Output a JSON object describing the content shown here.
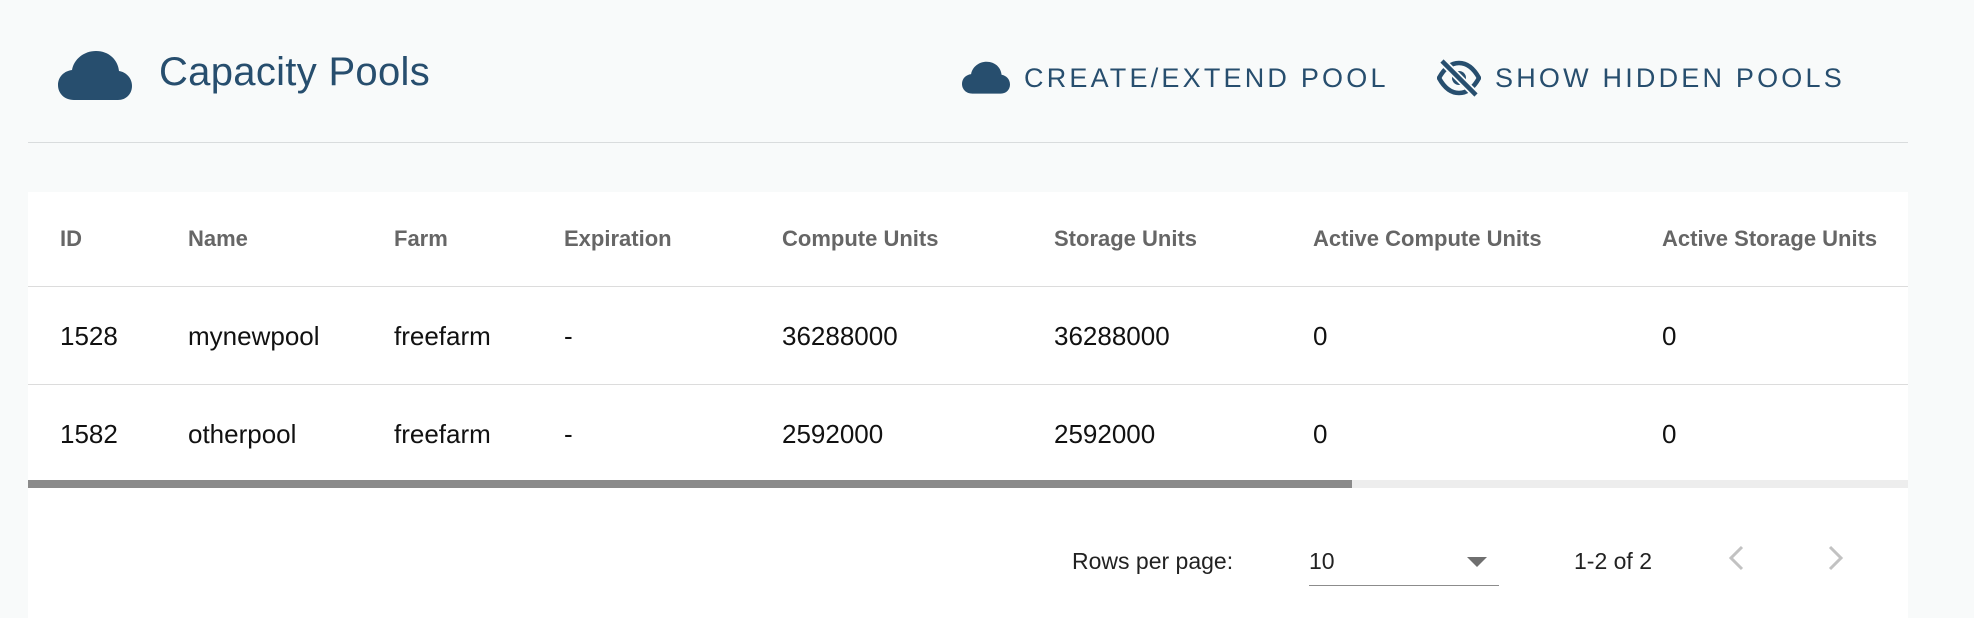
{
  "header": {
    "title": "Capacity Pools",
    "title_icon": "cloud-icon",
    "actions": [
      {
        "label": "CREATE/EXTEND POOL",
        "icon": "cloud-icon"
      },
      {
        "label": "SHOW HIDDEN POOLS",
        "icon": "eye-off-icon"
      }
    ],
    "accent_color": "#274e6e"
  },
  "table": {
    "columns": [
      "ID",
      "Name",
      "Farm",
      "Expiration",
      "Compute Units",
      "Storage Units",
      "Active Compute Units",
      "Active Storage Units"
    ],
    "rows": [
      [
        "1528",
        "mynewpool",
        "freefarm",
        "-",
        "36288000",
        "36288000",
        "0",
        "0"
      ],
      [
        "1582",
        "otherpool",
        "freefarm",
        "-",
        "2592000",
        "2592000",
        "0",
        "0"
      ]
    ]
  },
  "pagination": {
    "rows_per_page_label": "Rows per page:",
    "rows_per_page_value": "10",
    "range": "1-2 of 2",
    "prev_icon": "chevron-left-icon",
    "next_icon": "chevron-right-icon"
  }
}
